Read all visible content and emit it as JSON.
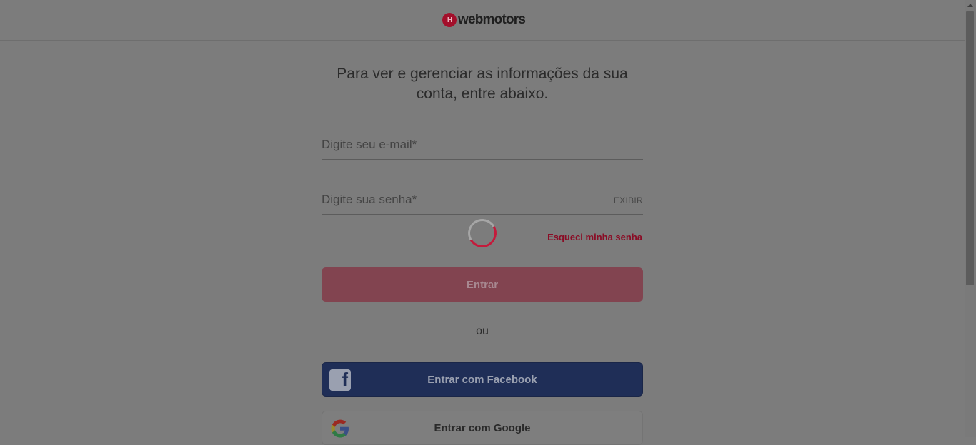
{
  "header": {
    "brand": "webmotors",
    "logo_mark": "H"
  },
  "headline": "Para ver e gerenciar as informações da sua conta, entre abaixo.",
  "email": {
    "placeholder": "Digite seu e-mail*",
    "value": ""
  },
  "password": {
    "placeholder": "Digite sua senha*",
    "value": "",
    "toggle_label": "EXIBIR"
  },
  "forgot_label": "Esqueci minha senha",
  "enter_label": "Entrar",
  "separator": "ou",
  "facebook": {
    "label": "Entrar com Facebook",
    "icon": "facebook-icon"
  },
  "google": {
    "label": "Entrar com Google",
    "icon": "google-icon"
  },
  "colors": {
    "brand": "#c41a3b",
    "facebook": "#1f2e57"
  }
}
